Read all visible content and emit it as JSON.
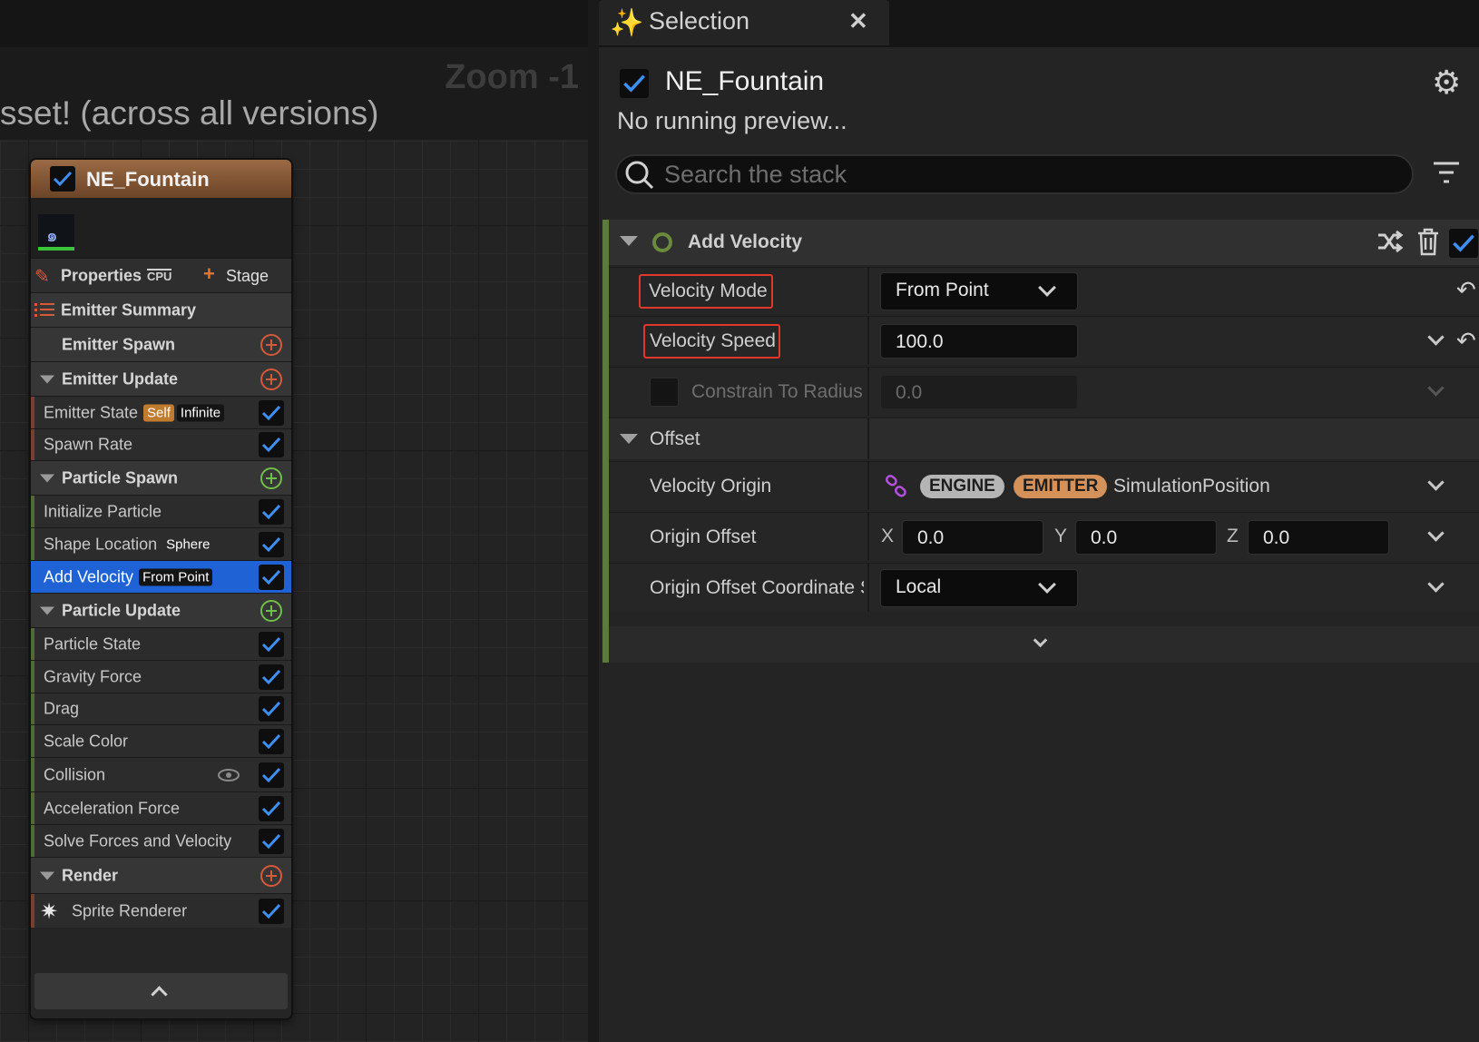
{
  "graph": {
    "zoom_label": "Zoom -1",
    "banner_text": "sset! (across all versions)"
  },
  "node": {
    "title": "NE_Fountain",
    "properties_label": "Properties",
    "cpu_label": "CPU",
    "stage_label": "Stage",
    "emitter_summary_label": "Emitter Summary",
    "rows": {
      "emitter_spawn": "Emitter Spawn",
      "emitter_update": "Emitter Update",
      "emitter_state": "Emitter State",
      "emitter_state_tag1": "Self",
      "emitter_state_tag2": "Infinite",
      "spawn_rate": "Spawn Rate",
      "particle_spawn": "Particle Spawn",
      "initialize_particle": "Initialize Particle",
      "shape_location": "Shape Location",
      "shape_location_tag": "Sphere",
      "add_velocity": "Add Velocity",
      "add_velocity_tag": "From Point",
      "particle_update": "Particle Update",
      "particle_state": "Particle State",
      "gravity_force": "Gravity Force",
      "drag": "Drag",
      "scale_color": "Scale Color",
      "collision": "Collision",
      "acceleration_force": "Acceleration Force",
      "solve_forces": "Solve Forces and Velocity",
      "render": "Render",
      "sprite_renderer": "Sprite Renderer"
    }
  },
  "selection": {
    "tab_title": "Selection",
    "emitter_name": "NE_Fountain",
    "preview_text": "No running preview...",
    "search_placeholder": "Search the stack",
    "module_title": "Add Velocity",
    "params": {
      "velocity_mode_label": "Velocity Mode",
      "velocity_mode_value": "From Point",
      "velocity_speed_label": "Velocity Speed",
      "velocity_speed_value": "100.0",
      "constrain_label": "Constrain To Radius",
      "constrain_value": "0.0",
      "offset_label": "Offset",
      "velocity_origin_label": "Velocity Origin",
      "engine_pill": "ENGINE",
      "emitter_pill": "EMITTER",
      "sim_position": "SimulationPosition",
      "origin_offset_label": "Origin Offset",
      "x_label": "X",
      "x_value": "0.0",
      "y_label": "Y",
      "y_value": "0.0",
      "z_label": "Z",
      "z_value": "0.0",
      "origin_coord_label": "Origin Offset Coordinate Space",
      "origin_coord_value": "Local"
    }
  },
  "colors": {
    "accent_blue": "#1f62d6",
    "check_blue": "#3d8ff0",
    "highlight_red": "#e0372a",
    "spawn_orange": "#d65a3a",
    "particle_green": "#6fbf4a"
  }
}
